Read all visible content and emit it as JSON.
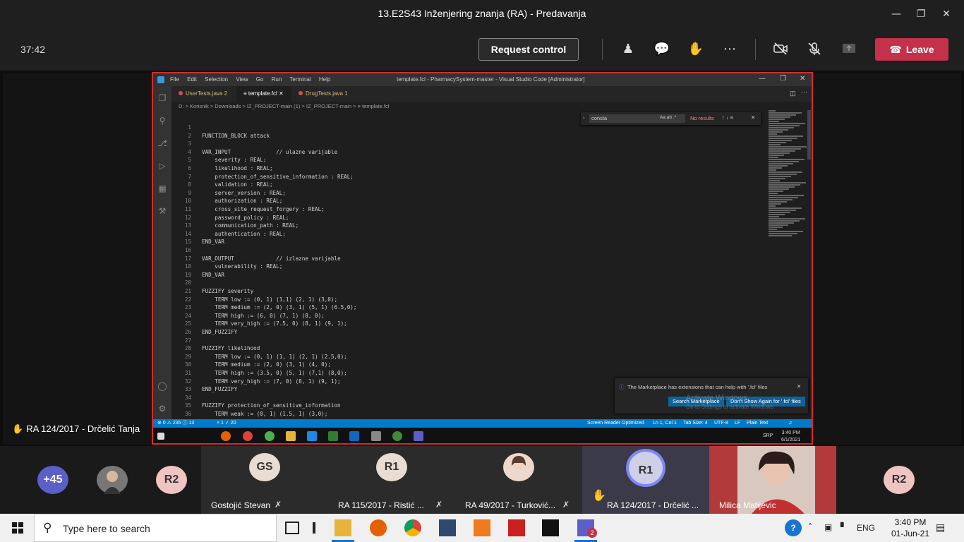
{
  "window": {
    "title": "13.E2S43 Inženjering znanja (RA) - Predavanja"
  },
  "toolbar": {
    "timer": "37:42",
    "request_control": "Request control",
    "leave": "Leave"
  },
  "vscode": {
    "menu": [
      "File",
      "Edit",
      "Selection",
      "View",
      "Go",
      "Run",
      "Terminal",
      "Help"
    ],
    "title": "template.fcl - PharmacySystem-master - Visual Studio Code [Administrator]",
    "tabs": [
      {
        "label": "UserTests.java 2"
      },
      {
        "label": "template.fcl"
      },
      {
        "label": "DrugTests.java 1"
      }
    ],
    "breadcrumb": "D: > Korisnik > Downloads > IZ_PROJECT-main (1) > IZ_PROJECT-main > ≡ template.fcl",
    "find": {
      "query": "consta",
      "result": "No results"
    },
    "code_lines": [
      {
        "n": "1",
        "t": ""
      },
      {
        "n": "2",
        "t": "FUNCTION_BLOCK attack"
      },
      {
        "n": "3",
        "t": ""
      },
      {
        "n": "4",
        "t": "VAR_INPUT              // ulazne varijable"
      },
      {
        "n": "5",
        "t": "    severity : REAL;"
      },
      {
        "n": "6",
        "t": "    likelihood : REAL;"
      },
      {
        "n": "7",
        "t": "    protection_of_sensitive_information : REAL;"
      },
      {
        "n": "8",
        "t": "    validation : REAL;"
      },
      {
        "n": "9",
        "t": "    server_version : REAL;"
      },
      {
        "n": "10",
        "t": "    authorization : REAL;"
      },
      {
        "n": "11",
        "t": "    cross_site_request_forgery : REAL;"
      },
      {
        "n": "12",
        "t": "    password_policy : REAL;"
      },
      {
        "n": "13",
        "t": "    communication_path : REAL;"
      },
      {
        "n": "14",
        "t": "    authentication : REAL;"
      },
      {
        "n": "15",
        "t": "END_VAR"
      },
      {
        "n": "16",
        "t": ""
      },
      {
        "n": "17",
        "t": "VAR_OUTPUT             // izlazne varijable"
      },
      {
        "n": "18",
        "t": "    vulnerability : REAL;"
      },
      {
        "n": "19",
        "t": "END_VAR"
      },
      {
        "n": "20",
        "t": ""
      },
      {
        "n": "21",
        "t": "FUZZIFY severity"
      },
      {
        "n": "22",
        "t": "    TERM low := (0, 1) (1,1) (2, 1) (3,0);"
      },
      {
        "n": "23",
        "t": "    TERM medium := (2, 0) (3, 1) (5, 1) (6.5,0);"
      },
      {
        "n": "24",
        "t": "    TERM high := (6, 0) (7, 1) (8, 0);"
      },
      {
        "n": "25",
        "t": "    TERM very_high := (7.5, 0) (8, 1) (9, 1);"
      },
      {
        "n": "26",
        "t": "END_FUZZIFY"
      },
      {
        "n": "27",
        "t": ""
      },
      {
        "n": "28",
        "t": "FUZZIFY likelihood"
      },
      {
        "n": "29",
        "t": "    TERM low := (0, 1) (1, 1) (2, 1) (2.5,0);"
      },
      {
        "n": "30",
        "t": "    TERM medium := (2, 0) (3, 1) (4, 0);"
      },
      {
        "n": "31",
        "t": "    TERM high := (3.5, 0) (5, 1) (7,1) (8,0);"
      },
      {
        "n": "32",
        "t": "    TERM very_high := (7, 0) (8, 1) (9, 1);"
      },
      {
        "n": "33",
        "t": "END_FUZZIFY"
      },
      {
        "n": "34",
        "t": ""
      },
      {
        "n": "35",
        "t": "FUZZIFY protection_of_sensitive_information"
      },
      {
        "n": "36",
        "t": "    TERM weak := (0, 1) (1.5, 1) (3,0);"
      }
    ],
    "notification": {
      "message": "The Marketplace has extensions that can help with '.fcl' files",
      "btn1": "Search Marketplace",
      "btn2": "Don't Show Again for '.fcl' files"
    },
    "watermark": {
      "line1": "Activate Windows",
      "line2": "Go to Settings to activate Windows."
    },
    "status": {
      "problems": "⊗ 0 ⚠ 235 ⓘ 13",
      "sync": "× 1 ✓ 20",
      "sr": "Screen Reader Optimized",
      "pos": "Ln 1, Col 1",
      "tab": "Tab Size: 4",
      "enc": "UTF-8",
      "eol": "LF",
      "lang": "Plain Text"
    },
    "inner_clock": {
      "lang": "SRP",
      "time": "3:40 PM",
      "date": "6/1/2021"
    }
  },
  "raised_hand": "RA 124/2017 - Drčelić Tanja",
  "participants": {
    "overflow": "+45",
    "r2a": "R2",
    "tiles": [
      {
        "initials": "GS",
        "name": "Gostojić Stevan"
      },
      {
        "initials": "R1",
        "name": "RA 115/2017 - Ristić ..."
      },
      {
        "initials": "",
        "name": "RA 49/2017 - Turković..."
      },
      {
        "initials": "R1",
        "name": "RA 124/2017 - Drčelić ..."
      },
      {
        "initials": "",
        "name": "Milica Matijevic"
      }
    ],
    "r2b": "R2"
  },
  "taskbar": {
    "search_placeholder": "Type here to search",
    "lang": "ENG",
    "time": "3:40 PM",
    "date": "01-Jun-21",
    "teams_badge": "2"
  }
}
